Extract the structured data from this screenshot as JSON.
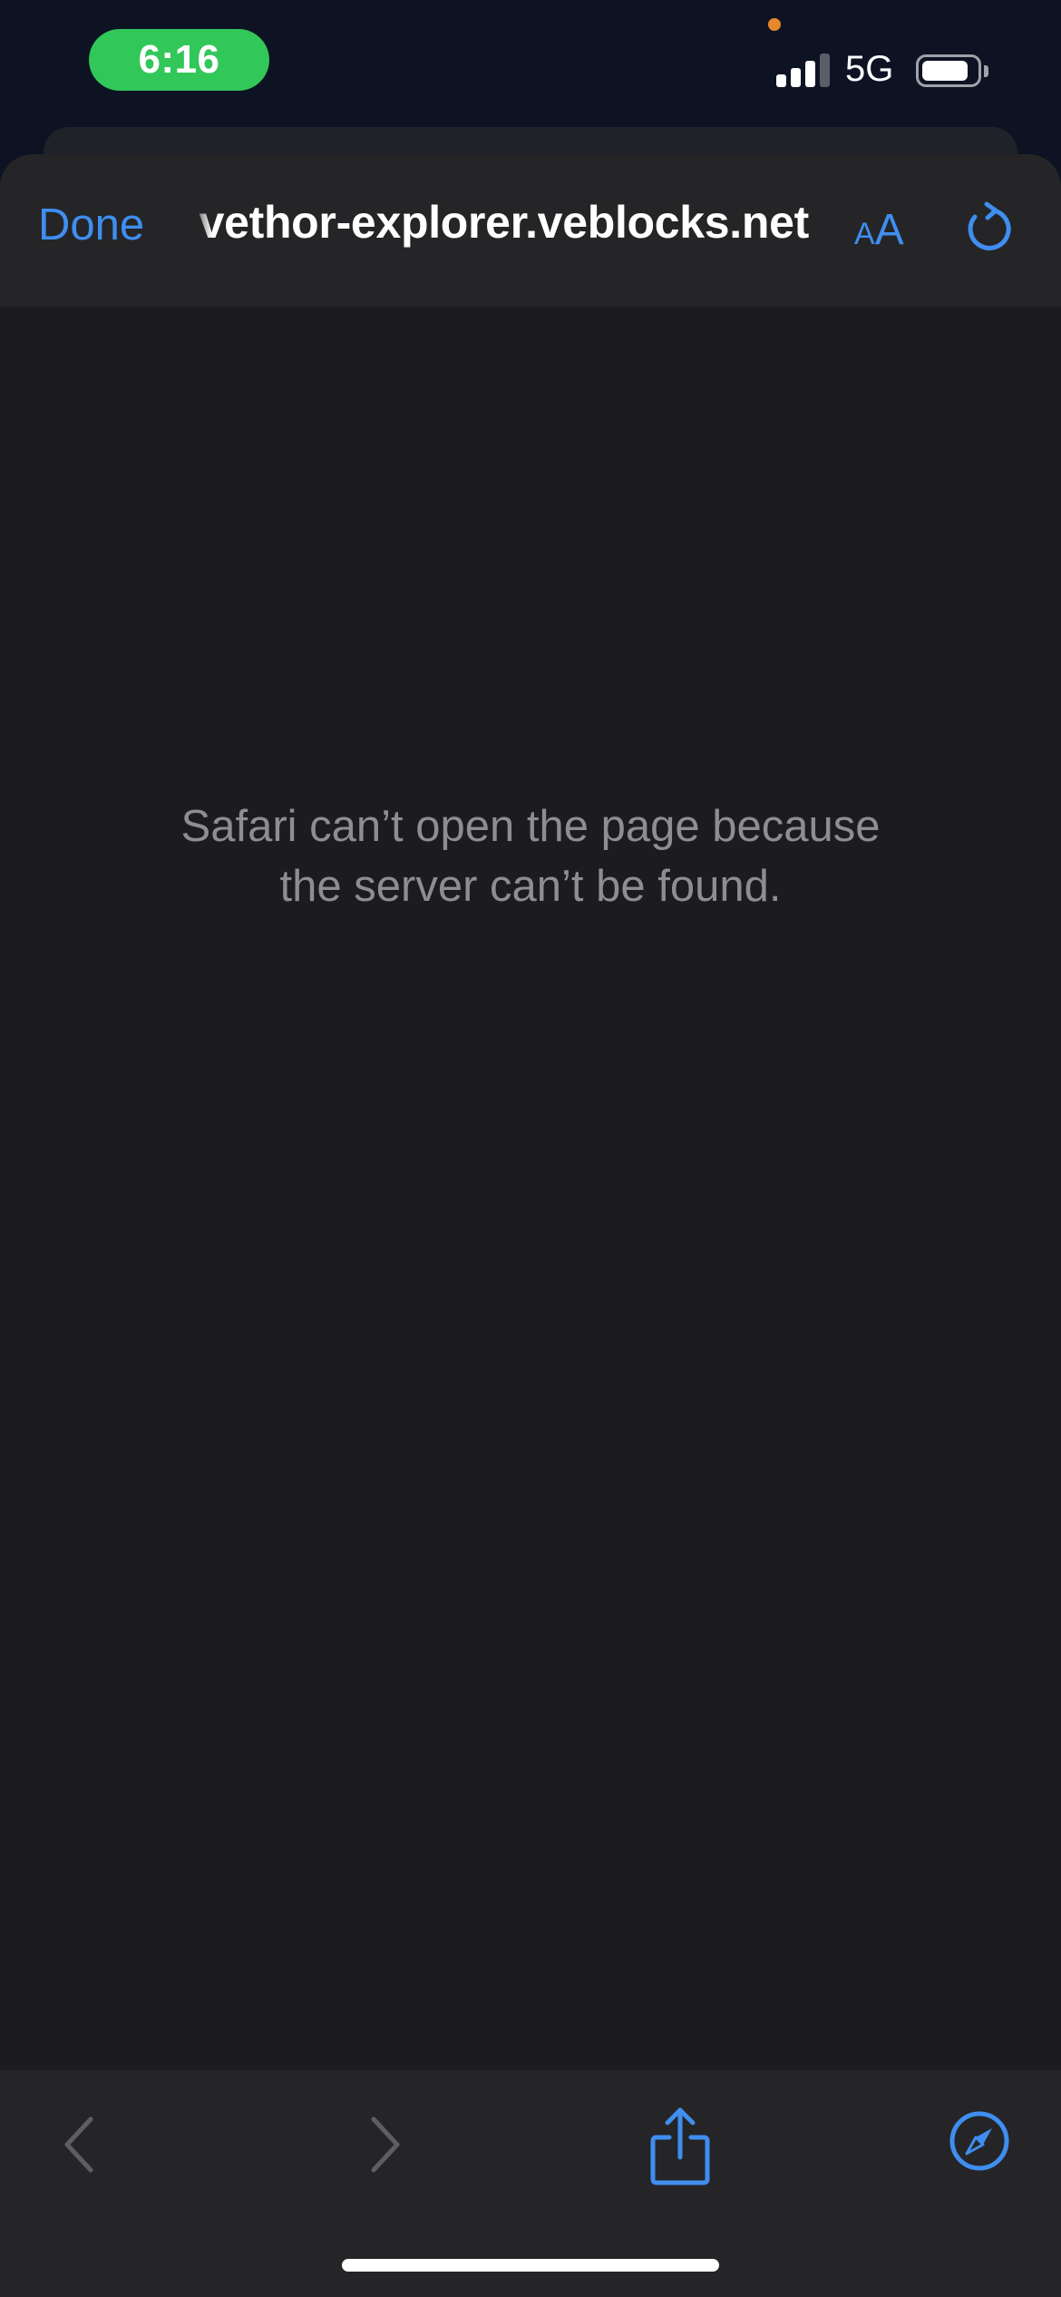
{
  "status_bar": {
    "time": "6:16",
    "network": "5G",
    "signal_bars_active": 3,
    "battery_level": 0.8,
    "colors": {
      "time_pill": "#31c759",
      "mic_indicator": "#e6892b"
    }
  },
  "browser": {
    "done_label": "Done",
    "url": "vethor-explorer.veblocks.net",
    "reader_small": "A",
    "reader_big": "A",
    "reload_icon": "reload-icon",
    "accent_color": "#3f8ef0"
  },
  "page": {
    "error_line_1": "Safari can’t open the page because",
    "error_line_2": "the server can’t be found."
  },
  "toolbar": {
    "back_icon": "chevron-left-icon",
    "forward_icon": "chevron-right-icon",
    "share_icon": "share-icon",
    "safari_icon": "compass-icon"
  }
}
